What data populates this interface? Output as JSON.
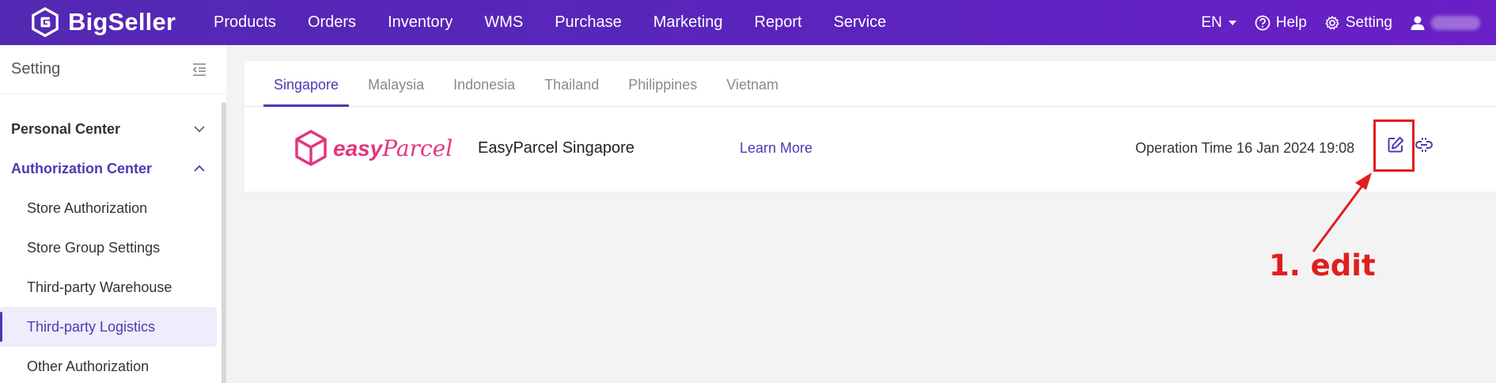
{
  "app": {
    "name": "BigSeller"
  },
  "nav": {
    "items": [
      "Products",
      "Orders",
      "Inventory",
      "WMS",
      "Purchase",
      "Marketing",
      "Report",
      "Service"
    ]
  },
  "top_right": {
    "language": "EN",
    "help": "Help",
    "setting": "Setting"
  },
  "sidebar": {
    "title": "Setting",
    "groups": [
      {
        "label": "Personal Center",
        "expanded": false
      },
      {
        "label": "Authorization Center",
        "expanded": true,
        "items": [
          "Store Authorization",
          "Store Group Settings",
          "Third-party Warehouse",
          "Third-party Logistics",
          "Other Authorization"
        ],
        "active_item": "Third-party Logistics"
      }
    ]
  },
  "tabs": {
    "items": [
      "Singapore",
      "Malaysia",
      "Indonesia",
      "Thailand",
      "Philippines",
      "Vietnam"
    ],
    "active": "Singapore"
  },
  "logistics": {
    "logo_text_bold": "easy",
    "logo_text_script": "Parcel",
    "name": "EasyParcel Singapore",
    "learn_more": "Learn More",
    "operation_time": "Operation Time 16 Jan 2024 19:08"
  },
  "annotation": {
    "label": "1. edit"
  },
  "colors": {
    "brand": "#5329b3",
    "accent": "#4f38b3",
    "logo_pink": "#e4357e",
    "annotation_red": "#e01e1e"
  },
  "icons": [
    "bigseller-logo-icon",
    "caret-down-icon",
    "help-circle-icon",
    "gear-icon",
    "user-icon",
    "collapse-menu-icon",
    "chevron-down-icon",
    "chevron-up-icon",
    "easyparcel-box-icon",
    "edit-icon",
    "unlink-icon"
  ]
}
